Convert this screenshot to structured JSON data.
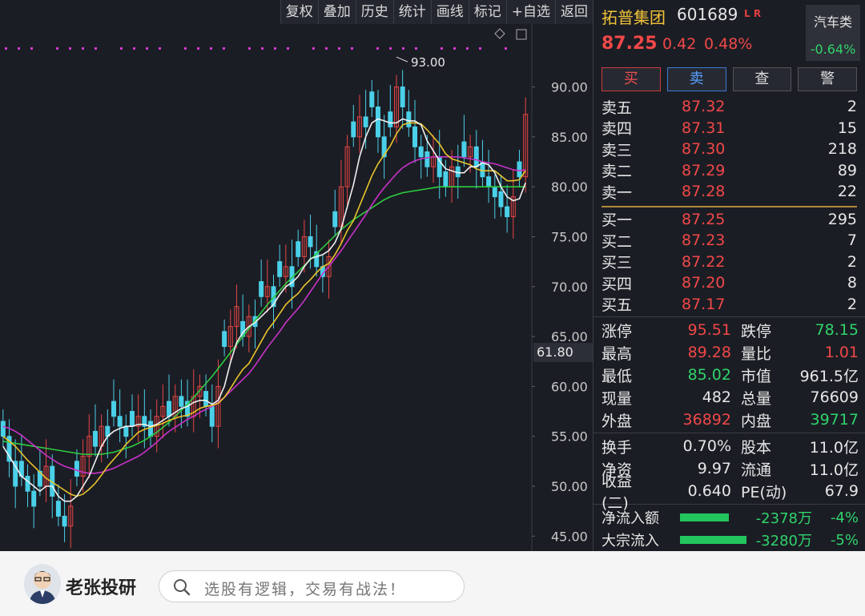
{
  "toolbar": [
    "复权",
    "叠加",
    "历史",
    "统计",
    "画线",
    "标记",
    "+自选",
    "返回"
  ],
  "chart": {
    "peak_label": "93.00",
    "current_axis_label": "61.80",
    "y_ticks": [
      "90.00",
      "85.00",
      "80.00",
      "75.00",
      "70.00",
      "65.00",
      "60.00",
      "55.00",
      "50.00",
      "45.00"
    ]
  },
  "chart_data": {
    "type": "candlestick",
    "y_ticks": [
      90,
      85,
      80,
      75,
      70,
      65,
      60,
      55,
      50,
      45
    ],
    "ylim": [
      43.5,
      95.5
    ],
    "peak": 93.0,
    "close_series": [
      55,
      52.5,
      50,
      51,
      49.5,
      48,
      50,
      52,
      49,
      47,
      46,
      48,
      51,
      53,
      55,
      54,
      56,
      55,
      57,
      56,
      55,
      56,
      57,
      56,
      55,
      57,
      58,
      57,
      59,
      58,
      57,
      59,
      60,
      58,
      56,
      60,
      64,
      66,
      68,
      65,
      67,
      66,
      69,
      70,
      68,
      71,
      72,
      70,
      73,
      75,
      74,
      72,
      71,
      73,
      76,
      80,
      84,
      85,
      87,
      86,
      88,
      85,
      83,
      86,
      90,
      88,
      86,
      84,
      83,
      82,
      83,
      81,
      80,
      82,
      81,
      83,
      84,
      82,
      81,
      80,
      79,
      78,
      77,
      79,
      81,
      87.25
    ],
    "ma5": [
      54,
      53,
      52,
      51,
      50.5,
      50,
      49.5,
      50,
      50,
      49,
      48.5,
      48.5,
      49,
      50,
      51,
      52.5,
      54,
      55,
      55.5,
      55.8,
      56,
      56,
      56.2,
      56.2,
      56,
      56.2,
      56.6,
      57,
      57.4,
      57.8,
      58,
      58.4,
      58.6,
      58.6,
      58.2,
      58.6,
      60,
      62.4,
      64.4,
      65.4,
      66,
      66.4,
      67,
      67.6,
      68.2,
      69.2,
      70,
      70.4,
      71,
      72,
      72.8,
      73,
      73.2,
      73.6,
      74.4,
      75.8,
      78,
      80.2,
      83,
      85,
      86.4,
      86.8,
      86.6,
      86.4,
      86.4,
      86.8,
      86.6,
      86.6,
      86.2,
      84.6,
      83.6,
      82.6,
      81.8,
      81.6,
      81.4,
      81.4,
      82,
      82,
      82.4,
      82.2,
      81.4,
      80,
      79,
      78.6,
      78.8,
      80.4
    ],
    "ma10": [
      55,
      54.5,
      54,
      53.3,
      52.6,
      52,
      51.4,
      50.8,
      50.4,
      50,
      49.6,
      49.2,
      49,
      49.2,
      49.7,
      50.3,
      51.1,
      52,
      52.7,
      53.4,
      54.2,
      54.8,
      55.4,
      55.7,
      55.9,
      56.1,
      56.3,
      56.6,
      56.8,
      57,
      57.1,
      57.4,
      57.8,
      58,
      58.1,
      58.3,
      58.9,
      59.8,
      60.8,
      61.7,
      62.3,
      63.4,
      64.5,
      65.6,
      66.4,
      67.3,
      68.2,
      68.8,
      69.3,
      70.1,
      70.7,
      71.4,
      72,
      72.3,
      73.2,
      74.3,
      75.6,
      76.6,
      78.1,
      79.6,
      81.1,
      82.3,
      83.2,
      84.1,
      85.3,
      86.2,
      86.4,
      86.4,
      86.3,
      85.7,
      85,
      84.3,
      83.3,
      82.8,
      82.6,
      82.4,
      82.2,
      81.8,
      81.6,
      81.6,
      81.6,
      81.1,
      80.6,
      80.6,
      80.7,
      81.6
    ],
    "ma20": [
      56,
      55.8,
      55.5,
      55.1,
      54.6,
      54.1,
      53.6,
      53.1,
      52.7,
      52.3,
      52,
      51.8,
      51.6,
      51.4,
      51.3,
      51.3,
      51.4,
      51.6,
      51.8,
      52.1,
      52.4,
      52.7,
      53,
      53.4,
      53.9,
      54.4,
      55,
      55.5,
      55.9,
      56.3,
      56.7,
      57,
      57.4,
      57.7,
      58,
      58.4,
      58.9,
      59.5,
      60.1,
      60.7,
      61.3,
      62.1,
      63,
      63.9,
      64.7,
      65.5,
      66.4,
      67.1,
      67.8,
      68.6,
      69.5,
      70.4,
      71.3,
      72,
      72.8,
      73.6,
      74.5,
      75.4,
      76.3,
      77.2,
      78.2,
      79.1,
      79.9,
      80.6,
      81.3,
      81.9,
      82.3,
      82.6,
      82.8,
      82.9,
      83,
      83,
      83,
      83,
      83,
      82.9,
      82.8,
      82.7,
      82.5,
      82.4,
      82.3,
      82.1,
      81.9,
      81.7,
      81.6,
      81.7
    ],
    "ma60": [
      54.5,
      54.4,
      54.3,
      54.2,
      54.1,
      54,
      53.9,
      53.8,
      53.7,
      53.6,
      53.5,
      53.4,
      53.3,
      53.2,
      53.2,
      53.2,
      53.2,
      53.3,
      53.4,
      53.6,
      53.8,
      54,
      54.3,
      54.6,
      55,
      55.4,
      55.9,
      56.4,
      57,
      57.6,
      58.2,
      58.9,
      59.6,
      60.3,
      61,
      61.8,
      62.6,
      63.4,
      64.2,
      65,
      65.8,
      66.6,
      67.4,
      68.2,
      68.9,
      69.6,
      70.3,
      70.9,
      71.5,
      72.1,
      72.7,
      73.3,
      73.9,
      74.5,
      75.1,
      75.7,
      76.2,
      76.7,
      77.1,
      77.5,
      77.9,
      78.3,
      78.7,
      79.0,
      79.2,
      79.4,
      79.5,
      79.6,
      79.7,
      79.8,
      79.9,
      80,
      80,
      80,
      80,
      80,
      80,
      80,
      80,
      80,
      80,
      80,
      80,
      80,
      80,
      80
    ]
  },
  "quote": {
    "name": "拓普集团",
    "code": "601689",
    "flags": "L R",
    "price": "87.25",
    "change": "0.42",
    "change_pct": "0.48%",
    "sector_name": "汽车类",
    "sector_change": "-0.64%",
    "buttons": [
      "买",
      "卖",
      "查",
      "警"
    ],
    "asks": [
      {
        "label": "卖五",
        "price": "87.32",
        "vol": "2"
      },
      {
        "label": "卖四",
        "price": "87.31",
        "vol": "15"
      },
      {
        "label": "卖三",
        "price": "87.30",
        "vol": "218"
      },
      {
        "label": "卖二",
        "price": "87.29",
        "vol": "89"
      },
      {
        "label": "卖一",
        "price": "87.28",
        "vol": "22"
      }
    ],
    "bids": [
      {
        "label": "买一",
        "price": "87.25",
        "vol": "295"
      },
      {
        "label": "买二",
        "price": "87.23",
        "vol": "7"
      },
      {
        "label": "买三",
        "price": "87.22",
        "vol": "2"
      },
      {
        "label": "买四",
        "price": "87.20",
        "vol": "8"
      },
      {
        "label": "买五",
        "price": "87.17",
        "vol": "2"
      }
    ],
    "stats1": [
      {
        "k": "涨停",
        "v": "95.51",
        "vc": "red",
        "k2": "跌停",
        "v2": "78.15",
        "v2c": "green"
      },
      {
        "k": "最高",
        "v": "89.28",
        "vc": "red",
        "k2": "量比",
        "v2": "1.01",
        "v2c": "red"
      },
      {
        "k": "最低",
        "v": "85.02",
        "vc": "green",
        "k2": "市值",
        "v2": "961.5亿",
        "v2c": "white"
      },
      {
        "k": "现量",
        "v": "482",
        "vc": "white",
        "k2": "总量",
        "v2": "76609",
        "v2c": "white"
      },
      {
        "k": "外盘",
        "v": "36892",
        "vc": "red",
        "k2": "内盘",
        "v2": "39717",
        "v2c": "green"
      }
    ],
    "stats2": [
      {
        "k": "换手",
        "v": "0.70%",
        "vc": "white",
        "k2": "股本",
        "v2": "11.0亿",
        "v2c": "white"
      },
      {
        "k": "净资",
        "v": "9.97",
        "vc": "white",
        "k2": "流通",
        "v2": "11.0亿",
        "v2c": "white"
      },
      {
        "k": "收益(二)",
        "v": "0.640",
        "vc": "white",
        "k2": "PE(动)",
        "v2": "67.9",
        "v2c": "white"
      }
    ],
    "flows": [
      {
        "k": "净流入额",
        "amt": "-2378万",
        "pct": "-4%",
        "bar": 0.55
      },
      {
        "k": "大宗流入",
        "amt": "-3280万",
        "pct": "-5%",
        "bar": 0.75
      }
    ]
  },
  "bottom": {
    "brand": "老张投研",
    "search_text": "选股有逻辑，交易有战法！"
  }
}
